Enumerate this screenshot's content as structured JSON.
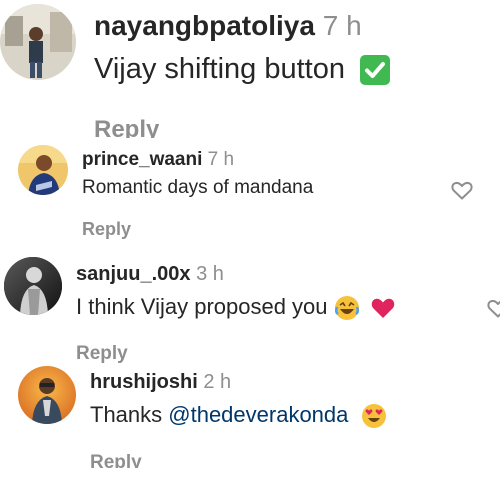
{
  "comments": [
    {
      "username": "nayangbpatoliya",
      "time": "7 h",
      "text": "Vijay shifting button",
      "reply_label": "Reply",
      "emoji": "check-mark-button"
    },
    {
      "username": "prince_waani",
      "time": "7 h",
      "text": "Romantic days of mandana",
      "reply_label": "Reply",
      "icon": "heart-outline-icon"
    },
    {
      "username": "sanjuu_.00x",
      "time": "3 h",
      "text": "I think Vijay proposed you",
      "reply_label": "Reply",
      "emoji": [
        "laughing-face",
        "red-heart"
      ],
      "icon": "heart-outline-icon"
    },
    {
      "username": "hrushijoshi",
      "time": "2 h",
      "text_before": "Thanks ",
      "mention": "@thedeverakonda",
      "reply_label": "Reply",
      "emoji": "heart-eyes-face"
    }
  ],
  "colors": {
    "text": "#262626",
    "secondary": "#8e8e8e",
    "mention": "#00376b",
    "check_green": "#3fb950",
    "heart_red": "#e0245e"
  }
}
